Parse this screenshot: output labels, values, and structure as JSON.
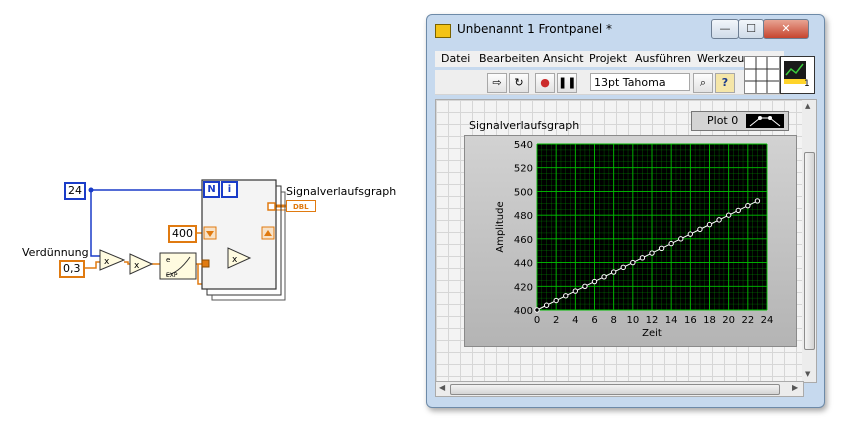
{
  "block_diagram": {
    "const_n": "24",
    "label_verduennung": "Verdünnung",
    "const_verduennung": "0,3",
    "const_400": "400",
    "terminal_n": "N",
    "terminal_i": "i",
    "label_graph": "Signalverlaufsgraph",
    "graph_terminal": "DBL"
  },
  "window": {
    "title": "Unbenannt 1 Frontpanel *",
    "minimize": "—",
    "maximize": "☐",
    "close": "✕",
    "menu": [
      "Datei",
      "Bearbeiten",
      "Ansicht",
      "Projekt",
      "Ausführen",
      "Werkzeuge"
    ],
    "font_select": "13pt Tahoma",
    "toolbar_help": "?",
    "vi_icon_number": "1"
  },
  "graph": {
    "title": "Signalverlaufsgraph",
    "legend": "Plot 0",
    "xlabel": "Zeit",
    "ylabel": "Amplitude",
    "colors": {
      "plot_bg": "#000000",
      "grid": "#00c000",
      "trace": "#ffffff"
    }
  },
  "chart_data": {
    "type": "line",
    "title": "Signalverlaufsgraph",
    "xlabel": "Zeit",
    "ylabel": "Amplitude",
    "xlim": [
      0,
      24
    ],
    "ylim": [
      400,
      540
    ],
    "xticks": [
      0,
      2,
      4,
      6,
      8,
      10,
      12,
      14,
      16,
      18,
      20,
      22,
      24
    ],
    "yticks": [
      400,
      420,
      440,
      460,
      480,
      500,
      520,
      540
    ],
    "grid": true,
    "series": [
      {
        "name": "Plot 0",
        "x": [
          0,
          1,
          2,
          3,
          4,
          5,
          6,
          7,
          8,
          9,
          10,
          11,
          12,
          13,
          14,
          15,
          16,
          17,
          18,
          19,
          20,
          21,
          22,
          23
        ],
        "values": [
          400,
          404,
          408,
          412,
          416,
          420,
          424,
          428,
          432,
          436,
          440,
          444,
          448,
          452,
          456,
          460,
          464,
          468,
          472,
          476,
          480,
          484,
          488,
          492
        ]
      }
    ]
  }
}
